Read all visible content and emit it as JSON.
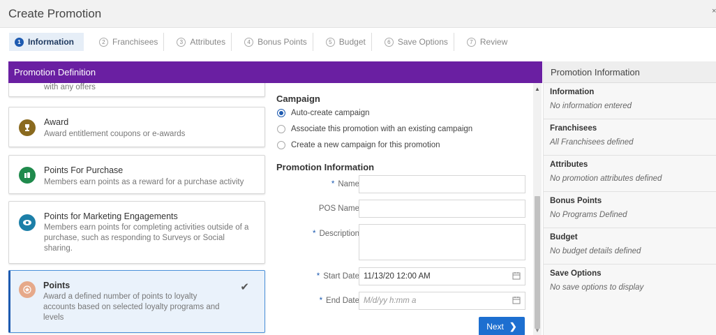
{
  "window": {
    "title": "Create Promotion",
    "close_glyph": "×"
  },
  "steps": [
    {
      "num": "1",
      "label": "Information"
    },
    {
      "num": "2",
      "label": "Franchisees"
    },
    {
      "num": "3",
      "label": "Attributes"
    },
    {
      "num": "4",
      "label": "Bonus Points"
    },
    {
      "num": "5",
      "label": "Budget"
    },
    {
      "num": "6",
      "label": "Save Options"
    },
    {
      "num": "7",
      "label": "Review"
    }
  ],
  "definition": {
    "header": "Promotion Definition",
    "cards": [
      {
        "name": "",
        "desc": "with any offers",
        "icon": "offers-icon"
      },
      {
        "name": "Award",
        "desc": "Award entitlement coupons or e-awards",
        "icon": "trophy-icon",
        "color": "#8a6a1f"
      },
      {
        "name": "Points For Purchase",
        "desc": "Members earn points as a reward for a purchase activity",
        "icon": "purchase-icon",
        "color": "#1f8a4c"
      },
      {
        "name": "Points for Marketing Engagements",
        "desc": "Members earn points for completing activities outside of a purchase, such as responding to Surveys or Social sharing.",
        "icon": "eye-icon",
        "color": "#1c7fa8"
      },
      {
        "name": "Points",
        "desc": "Award a defined number of points to loyalty accounts based on selected loyalty programs and levels",
        "icon": "star-icon",
        "color": "#e6a98a",
        "selected": true
      }
    ]
  },
  "form": {
    "campaign_title": "Campaign",
    "campaign_options": [
      {
        "label": "Auto-create campaign",
        "selected": true
      },
      {
        "label": "Associate this promotion with an existing campaign",
        "selected": false
      },
      {
        "label": "Create a new campaign for this promotion",
        "selected": false
      }
    ],
    "promo_title": "Promotion Information",
    "fields": {
      "name": {
        "label": "Name",
        "value": ""
      },
      "pos_name": {
        "label": "POS Name",
        "value": ""
      },
      "description": {
        "label": "Description",
        "value": ""
      },
      "start_date": {
        "label": "Start Date",
        "value": "11/13/20 12:00 AM"
      },
      "end_date": {
        "label": "End Date",
        "placeholder": "M/d/yy h:mm a"
      }
    },
    "next_label": "Next",
    "next_arrow": "❯",
    "required_mark": "*",
    "calendar_glyph": "📅",
    "check_glyph": "✔"
  },
  "info_panel": {
    "header": "Promotion Information",
    "sections": [
      {
        "title": "Information",
        "value": "No information entered"
      },
      {
        "title": "Franchisees",
        "value": "All Franchisees defined"
      },
      {
        "title": "Attributes",
        "value": "No promotion attributes defined"
      },
      {
        "title": "Bonus Points",
        "value": "No Programs Defined"
      },
      {
        "title": "Budget",
        "value": "No budget details defined"
      },
      {
        "title": "Save Options",
        "value": "No save options to display"
      }
    ]
  },
  "colors": {
    "accent": "#1d6fd0",
    "header_purple": "#6a1fa2",
    "selected_bg": "#eaf2fb"
  }
}
